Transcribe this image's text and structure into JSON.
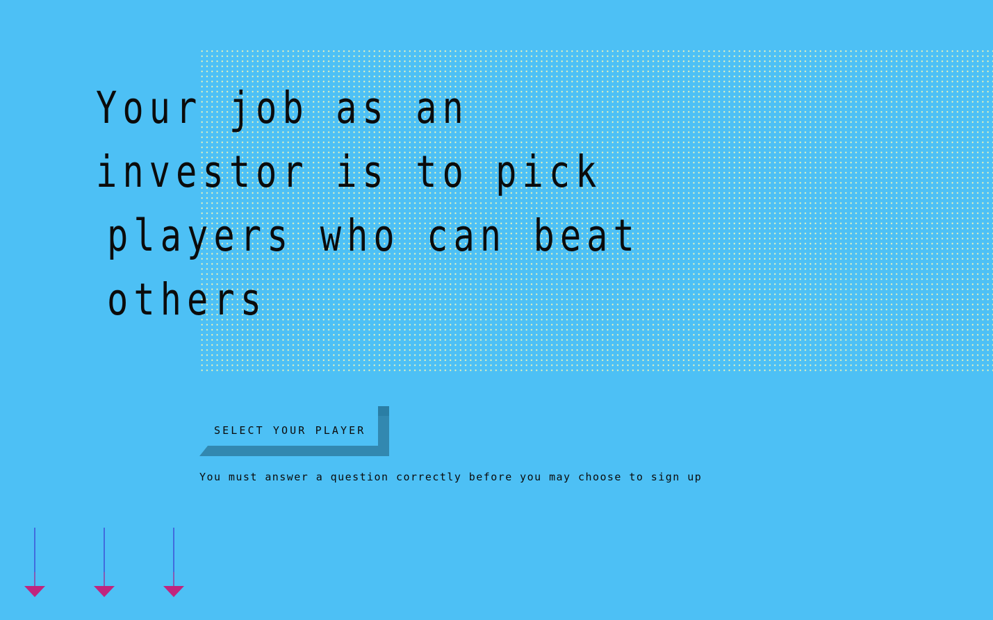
{
  "headline": {
    "lines": [
      "Your job as an",
      "investor is to pick",
      "players who can beat",
      "others"
    ]
  },
  "select_player": {
    "label": "SELECT YOUR PLAYER"
  },
  "notice": {
    "text": "You must answer a question correctly before you may choose to sign up"
  },
  "scroll_arrows": [
    {
      "icon": "down-arrow-icon"
    },
    {
      "icon": "down-arrow-icon"
    },
    {
      "icon": "down-arrow-icon"
    }
  ],
  "colors": {
    "background": "#4dc0f5",
    "dot_grid": "#f3f7b8",
    "button_shadow": "#3288b0",
    "arrow_shaft": "#3b3fd0",
    "arrow_head": "#c0257e",
    "text": "#0b0b0b"
  }
}
